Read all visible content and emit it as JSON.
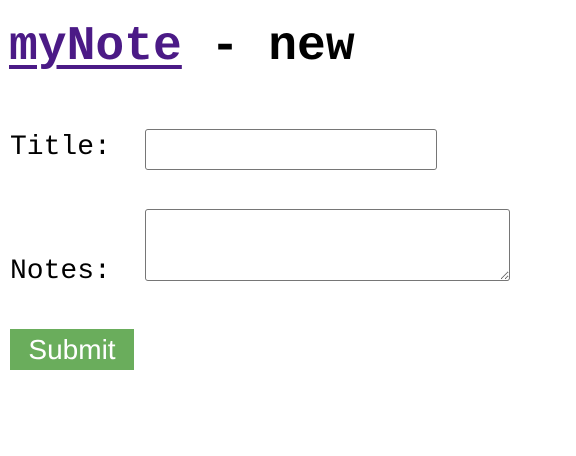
{
  "header": {
    "brand_link": "myNote",
    "suffix": " - new",
    "brand_color": "#4b1a86"
  },
  "form": {
    "title_label": "Title:",
    "title_value": "",
    "notes_label": "Notes:",
    "notes_value": "",
    "submit_label": "Submit",
    "submit_color": "#6aad5c"
  }
}
